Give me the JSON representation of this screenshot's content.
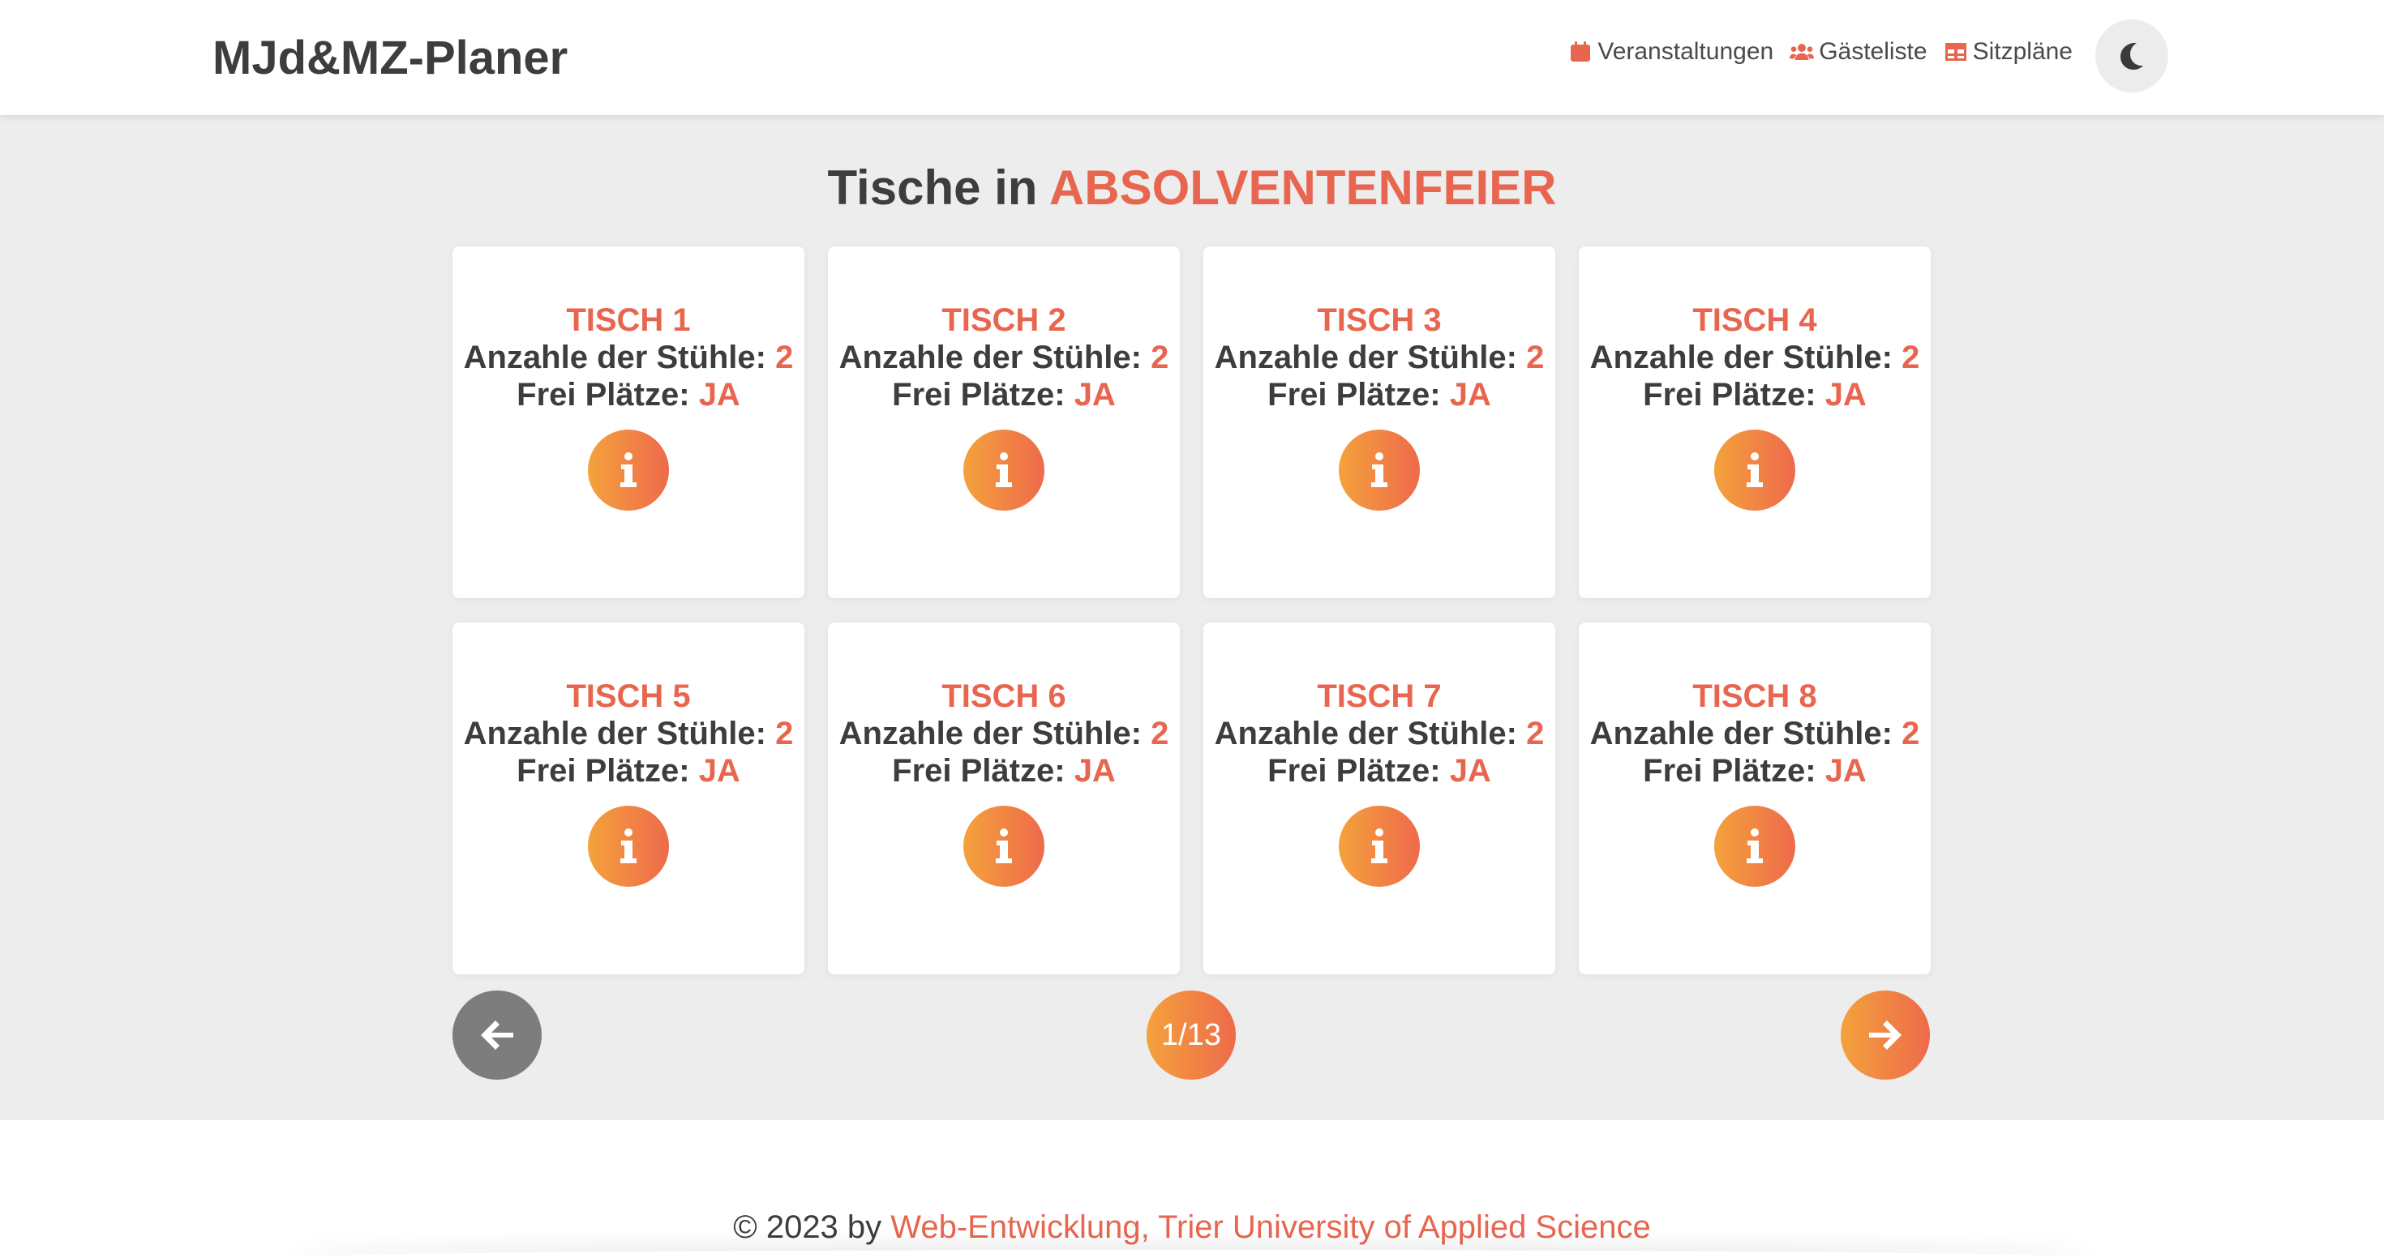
{
  "header": {
    "brand": "MJd&MZ-Planer",
    "nav": [
      {
        "label": "Veranstaltungen",
        "icon": "calendar-icon"
      },
      {
        "label": "Gästeliste",
        "icon": "users-icon"
      },
      {
        "label": "Sitzpläne",
        "icon": "table-icon"
      }
    ],
    "theme_toggle_icon": "moon-icon"
  },
  "main": {
    "heading_prefix": "Tische in",
    "heading_event": "ABSOLVENTENFEIER",
    "cards": [
      {
        "title": "TISCH 1",
        "chairs_label": "Anzahle der Stühle:",
        "chairs": "2",
        "free_label": "Frei Plätze:",
        "free": "JA"
      },
      {
        "title": "TISCH 2",
        "chairs_label": "Anzahle der Stühle:",
        "chairs": "2",
        "free_label": "Frei Plätze:",
        "free": "JA"
      },
      {
        "title": "TISCH 3",
        "chairs_label": "Anzahle der Stühle:",
        "chairs": "2",
        "free_label": "Frei Plätze:",
        "free": "JA"
      },
      {
        "title": "TISCH 4",
        "chairs_label": "Anzahle der Stühle:",
        "chairs": "2",
        "free_label": "Frei Plätze:",
        "free": "JA"
      },
      {
        "title": "TISCH 5",
        "chairs_label": "Anzahle der Stühle:",
        "chairs": "2",
        "free_label": "Frei Plätze:",
        "free": "JA"
      },
      {
        "title": "TISCH 6",
        "chairs_label": "Anzahle der Stühle:",
        "chairs": "2",
        "free_label": "Frei Plätze:",
        "free": "JA"
      },
      {
        "title": "TISCH 7",
        "chairs_label": "Anzahle der Stühle:",
        "chairs": "2",
        "free_label": "Frei Plätze:",
        "free": "JA"
      },
      {
        "title": "TISCH 8",
        "chairs_label": "Anzahle der Stühle:",
        "chairs": "2",
        "free_label": "Frei Plätze:",
        "free": "JA"
      }
    ],
    "pager": {
      "page": "1/13",
      "prev_icon": "arrow-left-icon",
      "next_icon": "arrow-right-icon"
    }
  },
  "footer": {
    "prefix": "© 2023 by",
    "link": "Web-Entwicklung, Trier University of Applied Science"
  },
  "colors": {
    "accent": "#e8664f",
    "gradient_start": "#f4a23c",
    "gradient_end": "#ee6a4b",
    "background": "#ededed",
    "text": "#3d3d3d"
  }
}
